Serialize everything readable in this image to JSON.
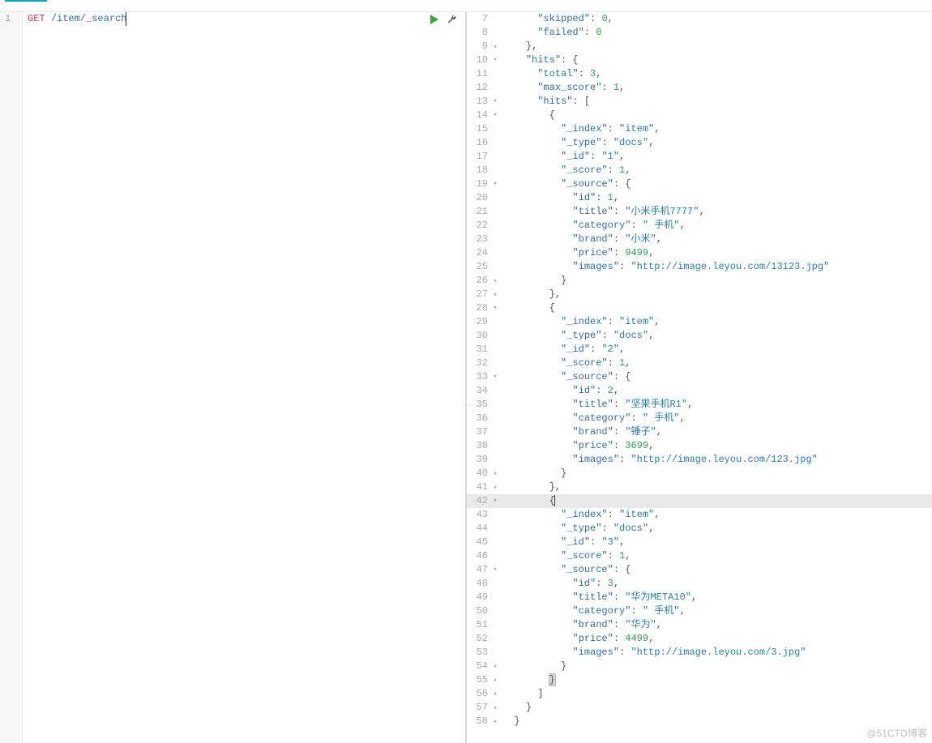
{
  "request": {
    "method": "GET",
    "path": "/item/_search"
  },
  "left_panel": {
    "line_numbers": [
      "1"
    ]
  },
  "response_lines": [
    {
      "n": 7,
      "fold": "",
      "ind": 3,
      "tokens": [
        [
          "key",
          "\"skipped\""
        ],
        [
          "pun",
          ": "
        ],
        [
          "num",
          "0"
        ],
        [
          "pun",
          ","
        ]
      ]
    },
    {
      "n": 8,
      "fold": "",
      "ind": 3,
      "tokens": [
        [
          "key",
          "\"failed\""
        ],
        [
          "pun",
          ": "
        ],
        [
          "num",
          "0"
        ]
      ]
    },
    {
      "n": 9,
      "fold": "▴",
      "ind": 2,
      "tokens": [
        [
          "pun",
          "},"
        ]
      ]
    },
    {
      "n": 10,
      "fold": "▾",
      "ind": 2,
      "tokens": [
        [
          "key",
          "\"hits\""
        ],
        [
          "pun",
          ": {"
        ]
      ]
    },
    {
      "n": 11,
      "fold": "",
      "ind": 3,
      "tokens": [
        [
          "key",
          "\"total\""
        ],
        [
          "pun",
          ": "
        ],
        [
          "num",
          "3"
        ],
        [
          "pun",
          ","
        ]
      ]
    },
    {
      "n": 12,
      "fold": "",
      "ind": 3,
      "tokens": [
        [
          "key",
          "\"max_score\""
        ],
        [
          "pun",
          ": "
        ],
        [
          "num",
          "1"
        ],
        [
          "pun",
          ","
        ]
      ]
    },
    {
      "n": 13,
      "fold": "▾",
      "ind": 3,
      "tokens": [
        [
          "key",
          "\"hits\""
        ],
        [
          "pun",
          ": ["
        ]
      ]
    },
    {
      "n": 14,
      "fold": "▾",
      "ind": 4,
      "tokens": [
        [
          "pun",
          "{"
        ]
      ]
    },
    {
      "n": 15,
      "fold": "",
      "ind": 5,
      "tokens": [
        [
          "key",
          "\"_index\""
        ],
        [
          "pun",
          ": "
        ],
        [
          "str",
          "\"item\""
        ],
        [
          "pun",
          ","
        ]
      ]
    },
    {
      "n": 16,
      "fold": "",
      "ind": 5,
      "tokens": [
        [
          "key",
          "\"_type\""
        ],
        [
          "pun",
          ": "
        ],
        [
          "str",
          "\"docs\""
        ],
        [
          "pun",
          ","
        ]
      ]
    },
    {
      "n": 17,
      "fold": "",
      "ind": 5,
      "tokens": [
        [
          "key",
          "\"_id\""
        ],
        [
          "pun",
          ": "
        ],
        [
          "str",
          "\"1\""
        ],
        [
          "pun",
          ","
        ]
      ]
    },
    {
      "n": 18,
      "fold": "",
      "ind": 5,
      "tokens": [
        [
          "key",
          "\"_score\""
        ],
        [
          "pun",
          ": "
        ],
        [
          "num",
          "1"
        ],
        [
          "pun",
          ","
        ]
      ]
    },
    {
      "n": 19,
      "fold": "▾",
      "ind": 5,
      "tokens": [
        [
          "key",
          "\"_source\""
        ],
        [
          "pun",
          ": {"
        ]
      ]
    },
    {
      "n": 20,
      "fold": "",
      "ind": 6,
      "tokens": [
        [
          "key",
          "\"id\""
        ],
        [
          "pun",
          ": "
        ],
        [
          "num",
          "1"
        ],
        [
          "pun",
          ","
        ]
      ]
    },
    {
      "n": 21,
      "fold": "",
      "ind": 6,
      "tokens": [
        [
          "key",
          "\"title\""
        ],
        [
          "pun",
          ": "
        ],
        [
          "str",
          "\"小米手机7777\""
        ],
        [
          "pun",
          ","
        ]
      ]
    },
    {
      "n": 22,
      "fold": "",
      "ind": 6,
      "tokens": [
        [
          "key",
          "\"category\""
        ],
        [
          "pun",
          ": "
        ],
        [
          "str",
          "\" 手机\""
        ],
        [
          "pun",
          ","
        ]
      ]
    },
    {
      "n": 23,
      "fold": "",
      "ind": 6,
      "tokens": [
        [
          "key",
          "\"brand\""
        ],
        [
          "pun",
          ": "
        ],
        [
          "str",
          "\"小米\""
        ],
        [
          "pun",
          ","
        ]
      ]
    },
    {
      "n": 24,
      "fold": "",
      "ind": 6,
      "tokens": [
        [
          "key",
          "\"price\""
        ],
        [
          "pun",
          ": "
        ],
        [
          "num",
          "9499"
        ],
        [
          "pun",
          ","
        ]
      ]
    },
    {
      "n": 25,
      "fold": "",
      "ind": 6,
      "tokens": [
        [
          "key",
          "\"images\""
        ],
        [
          "pun",
          ": "
        ],
        [
          "str",
          "\"http://image.leyou.com/13123.jpg\""
        ]
      ]
    },
    {
      "n": 26,
      "fold": "▴",
      "ind": 5,
      "tokens": [
        [
          "pun",
          "}"
        ]
      ]
    },
    {
      "n": 27,
      "fold": "▴",
      "ind": 4,
      "tokens": [
        [
          "pun",
          "},"
        ]
      ]
    },
    {
      "n": 28,
      "fold": "▾",
      "ind": 4,
      "tokens": [
        [
          "pun",
          "{"
        ]
      ]
    },
    {
      "n": 29,
      "fold": "",
      "ind": 5,
      "tokens": [
        [
          "key",
          "\"_index\""
        ],
        [
          "pun",
          ": "
        ],
        [
          "str",
          "\"item\""
        ],
        [
          "pun",
          ","
        ]
      ]
    },
    {
      "n": 30,
      "fold": "",
      "ind": 5,
      "tokens": [
        [
          "key",
          "\"_type\""
        ],
        [
          "pun",
          ": "
        ],
        [
          "str",
          "\"docs\""
        ],
        [
          "pun",
          ","
        ]
      ]
    },
    {
      "n": 31,
      "fold": "",
      "ind": 5,
      "tokens": [
        [
          "key",
          "\"_id\""
        ],
        [
          "pun",
          ": "
        ],
        [
          "str",
          "\"2\""
        ],
        [
          "pun",
          ","
        ]
      ]
    },
    {
      "n": 32,
      "fold": "",
      "ind": 5,
      "tokens": [
        [
          "key",
          "\"_score\""
        ],
        [
          "pun",
          ": "
        ],
        [
          "num",
          "1"
        ],
        [
          "pun",
          ","
        ]
      ]
    },
    {
      "n": 33,
      "fold": "▾",
      "ind": 5,
      "tokens": [
        [
          "key",
          "\"_source\""
        ],
        [
          "pun",
          ": {"
        ]
      ]
    },
    {
      "n": 34,
      "fold": "",
      "ind": 6,
      "tokens": [
        [
          "key",
          "\"id\""
        ],
        [
          "pun",
          ": "
        ],
        [
          "num",
          "2"
        ],
        [
          "pun",
          ","
        ]
      ]
    },
    {
      "n": 35,
      "fold": "",
      "ind": 6,
      "tokens": [
        [
          "key",
          "\"title\""
        ],
        [
          "pun",
          ": "
        ],
        [
          "str",
          "\"坚果手机R1\""
        ],
        [
          "pun",
          ","
        ]
      ]
    },
    {
      "n": 36,
      "fold": "",
      "ind": 6,
      "tokens": [
        [
          "key",
          "\"category\""
        ],
        [
          "pun",
          ": "
        ],
        [
          "str",
          "\" 手机\""
        ],
        [
          "pun",
          ","
        ]
      ]
    },
    {
      "n": 37,
      "fold": "",
      "ind": 6,
      "tokens": [
        [
          "key",
          "\"brand\""
        ],
        [
          "pun",
          ": "
        ],
        [
          "str",
          "\"锤子\""
        ],
        [
          "pun",
          ","
        ]
      ]
    },
    {
      "n": 38,
      "fold": "",
      "ind": 6,
      "tokens": [
        [
          "key",
          "\"price\""
        ],
        [
          "pun",
          ": "
        ],
        [
          "num",
          "3699"
        ],
        [
          "pun",
          ","
        ]
      ]
    },
    {
      "n": 39,
      "fold": "",
      "ind": 6,
      "tokens": [
        [
          "key",
          "\"images\""
        ],
        [
          "pun",
          ": "
        ],
        [
          "str",
          "\"http://image.leyou.com/123.jpg\""
        ]
      ]
    },
    {
      "n": 40,
      "fold": "▴",
      "ind": 5,
      "tokens": [
        [
          "pun",
          "}"
        ]
      ]
    },
    {
      "n": 41,
      "fold": "▴",
      "ind": 4,
      "tokens": [
        [
          "pun",
          "},"
        ]
      ]
    },
    {
      "n": 42,
      "fold": "▾",
      "ind": 4,
      "hl": true,
      "tokens": [
        [
          "pun",
          "{"
        ]
      ],
      "cursor": true
    },
    {
      "n": 43,
      "fold": "",
      "ind": 5,
      "tokens": [
        [
          "key",
          "\"_index\""
        ],
        [
          "pun",
          ": "
        ],
        [
          "str",
          "\"item\""
        ],
        [
          "pun",
          ","
        ]
      ]
    },
    {
      "n": 44,
      "fold": "",
      "ind": 5,
      "tokens": [
        [
          "key",
          "\"_type\""
        ],
        [
          "pun",
          ": "
        ],
        [
          "str",
          "\"docs\""
        ],
        [
          "pun",
          ","
        ]
      ]
    },
    {
      "n": 45,
      "fold": "",
      "ind": 5,
      "tokens": [
        [
          "key",
          "\"_id\""
        ],
        [
          "pun",
          ": "
        ],
        [
          "str",
          "\"3\""
        ],
        [
          "pun",
          ","
        ]
      ]
    },
    {
      "n": 46,
      "fold": "",
      "ind": 5,
      "tokens": [
        [
          "key",
          "\"_score\""
        ],
        [
          "pun",
          ": "
        ],
        [
          "num",
          "1"
        ],
        [
          "pun",
          ","
        ]
      ]
    },
    {
      "n": 47,
      "fold": "▾",
      "ind": 5,
      "tokens": [
        [
          "key",
          "\"_source\""
        ],
        [
          "pun",
          ": {"
        ]
      ]
    },
    {
      "n": 48,
      "fold": "",
      "ind": 6,
      "tokens": [
        [
          "key",
          "\"id\""
        ],
        [
          "pun",
          ": "
        ],
        [
          "num",
          "3"
        ],
        [
          "pun",
          ","
        ]
      ]
    },
    {
      "n": 49,
      "fold": "",
      "ind": 6,
      "tokens": [
        [
          "key",
          "\"title\""
        ],
        [
          "pun",
          ": "
        ],
        [
          "str",
          "\"华为META10\""
        ],
        [
          "pun",
          ","
        ]
      ]
    },
    {
      "n": 50,
      "fold": "",
      "ind": 6,
      "tokens": [
        [
          "key",
          "\"category\""
        ],
        [
          "pun",
          ": "
        ],
        [
          "str",
          "\" 手机\""
        ],
        [
          "pun",
          ","
        ]
      ]
    },
    {
      "n": 51,
      "fold": "",
      "ind": 6,
      "tokens": [
        [
          "key",
          "\"brand\""
        ],
        [
          "pun",
          ": "
        ],
        [
          "str",
          "\"华为\""
        ],
        [
          "pun",
          ","
        ]
      ]
    },
    {
      "n": 52,
      "fold": "",
      "ind": 6,
      "tokens": [
        [
          "key",
          "\"price\""
        ],
        [
          "pun",
          ": "
        ],
        [
          "num",
          "4499"
        ],
        [
          "pun",
          ","
        ]
      ]
    },
    {
      "n": 53,
      "fold": "",
      "ind": 6,
      "tokens": [
        [
          "key",
          "\"images\""
        ],
        [
          "pun",
          ": "
        ],
        [
          "str",
          "\"http://image.leyou.com/3.jpg\""
        ]
      ]
    },
    {
      "n": 54,
      "fold": "▴",
      "ind": 5,
      "tokens": [
        [
          "pun",
          "}"
        ]
      ]
    },
    {
      "n": 55,
      "fold": "▴",
      "ind": 4,
      "hlpun": true,
      "tokens": [
        [
          "pun",
          "}"
        ]
      ]
    },
    {
      "n": 56,
      "fold": "▴",
      "ind": 3,
      "tokens": [
        [
          "pun",
          "]"
        ]
      ]
    },
    {
      "n": 57,
      "fold": "▴",
      "ind": 2,
      "tokens": [
        [
          "pun",
          "}"
        ]
      ]
    },
    {
      "n": 58,
      "fold": "▴",
      "ind": 1,
      "tokens": [
        [
          "pun",
          "}"
        ]
      ]
    }
  ],
  "watermark": "@51CTO博客"
}
